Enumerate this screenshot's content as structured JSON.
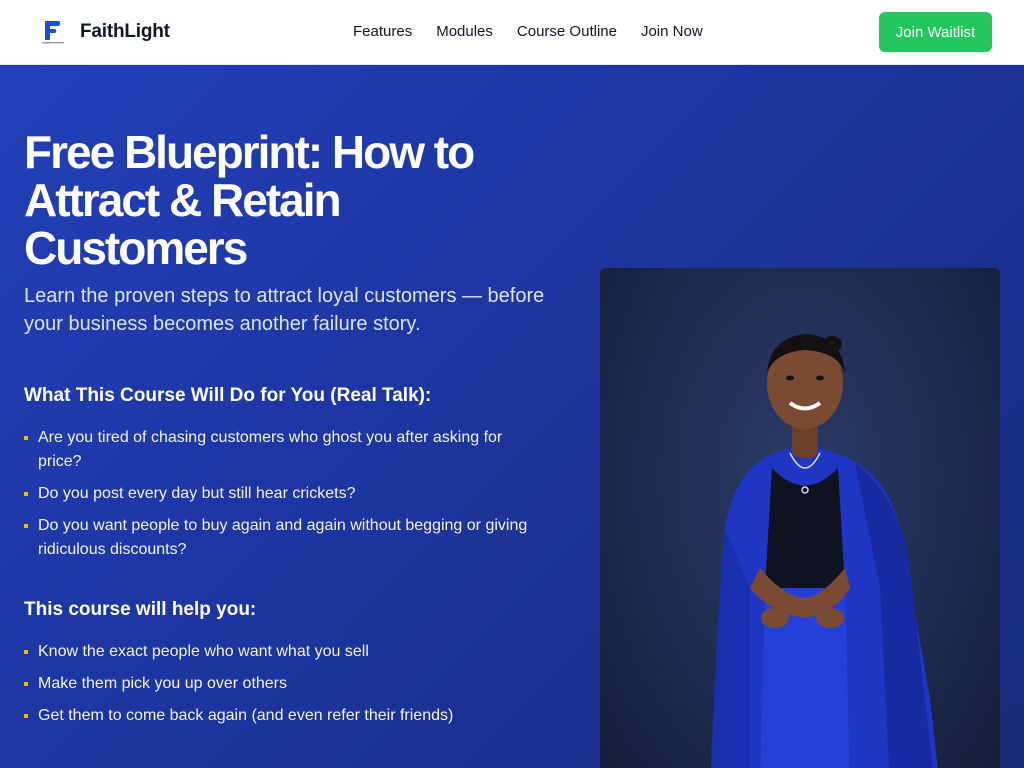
{
  "header": {
    "brand_name": "FaithLight",
    "nav": [
      "Features",
      "Modules",
      "Course Outline",
      "Join Now"
    ],
    "cta_label": "Join Waitlist"
  },
  "hero": {
    "title": "Free Blueprint: How to Attract & Retain Customers",
    "subtitle": "Learn the proven steps to attract loyal customers — before your business becomes another failure story.",
    "section1": {
      "heading": "What This Course Will Do for You (Real Talk):",
      "items": [
        "Are you tired of chasing customers who ghost you after asking for price?",
        "Do you post every day but still hear crickets?",
        "Do you want people to buy again and again without begging or giving ridiculous discounts?"
      ]
    },
    "section2": {
      "heading": "This course will help you:",
      "items": [
        "Know the exact people who want what you sell",
        "Make them pick you up over others",
        "Get them to come back again (and even refer their friends)"
      ]
    }
  },
  "colors": {
    "accent_green": "#22c55e",
    "hero_blue": "#1f3aa8",
    "bullet_gold": "#f5b700"
  }
}
